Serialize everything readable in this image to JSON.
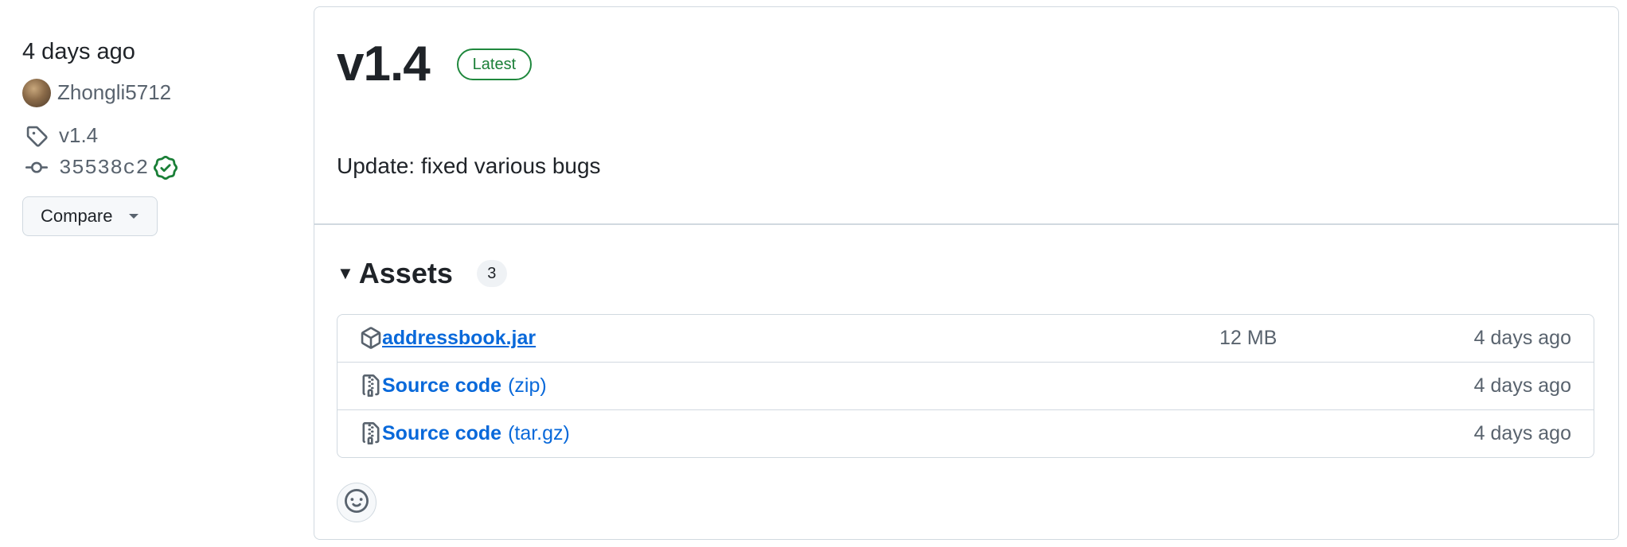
{
  "sidebar": {
    "relative_date": "4 days ago",
    "author": "Zhongli5712",
    "tag": "v1.4",
    "commit": "35538c2",
    "compare_label": "Compare"
  },
  "release": {
    "version": "v1.4",
    "badge": "Latest",
    "body": "Update: fixed various bugs"
  },
  "assets": {
    "title": "Assets",
    "count": "3",
    "items": [
      {
        "name": "addressbook.jar",
        "suffix": "",
        "size": "12 MB",
        "date": "4 days ago",
        "icon": "package-icon"
      },
      {
        "name": "Source code",
        "suffix": "(zip)",
        "size": "",
        "date": "4 days ago",
        "icon": "file-zip-icon"
      },
      {
        "name": "Source code",
        "suffix": "(tar.gz)",
        "size": "",
        "date": "4 days ago",
        "icon": "file-zip-icon"
      }
    ]
  },
  "colors": {
    "link": "#0969da",
    "latest_green": "#1a7f37",
    "border": "#d1d9e0",
    "muted_text": "#59636e"
  }
}
